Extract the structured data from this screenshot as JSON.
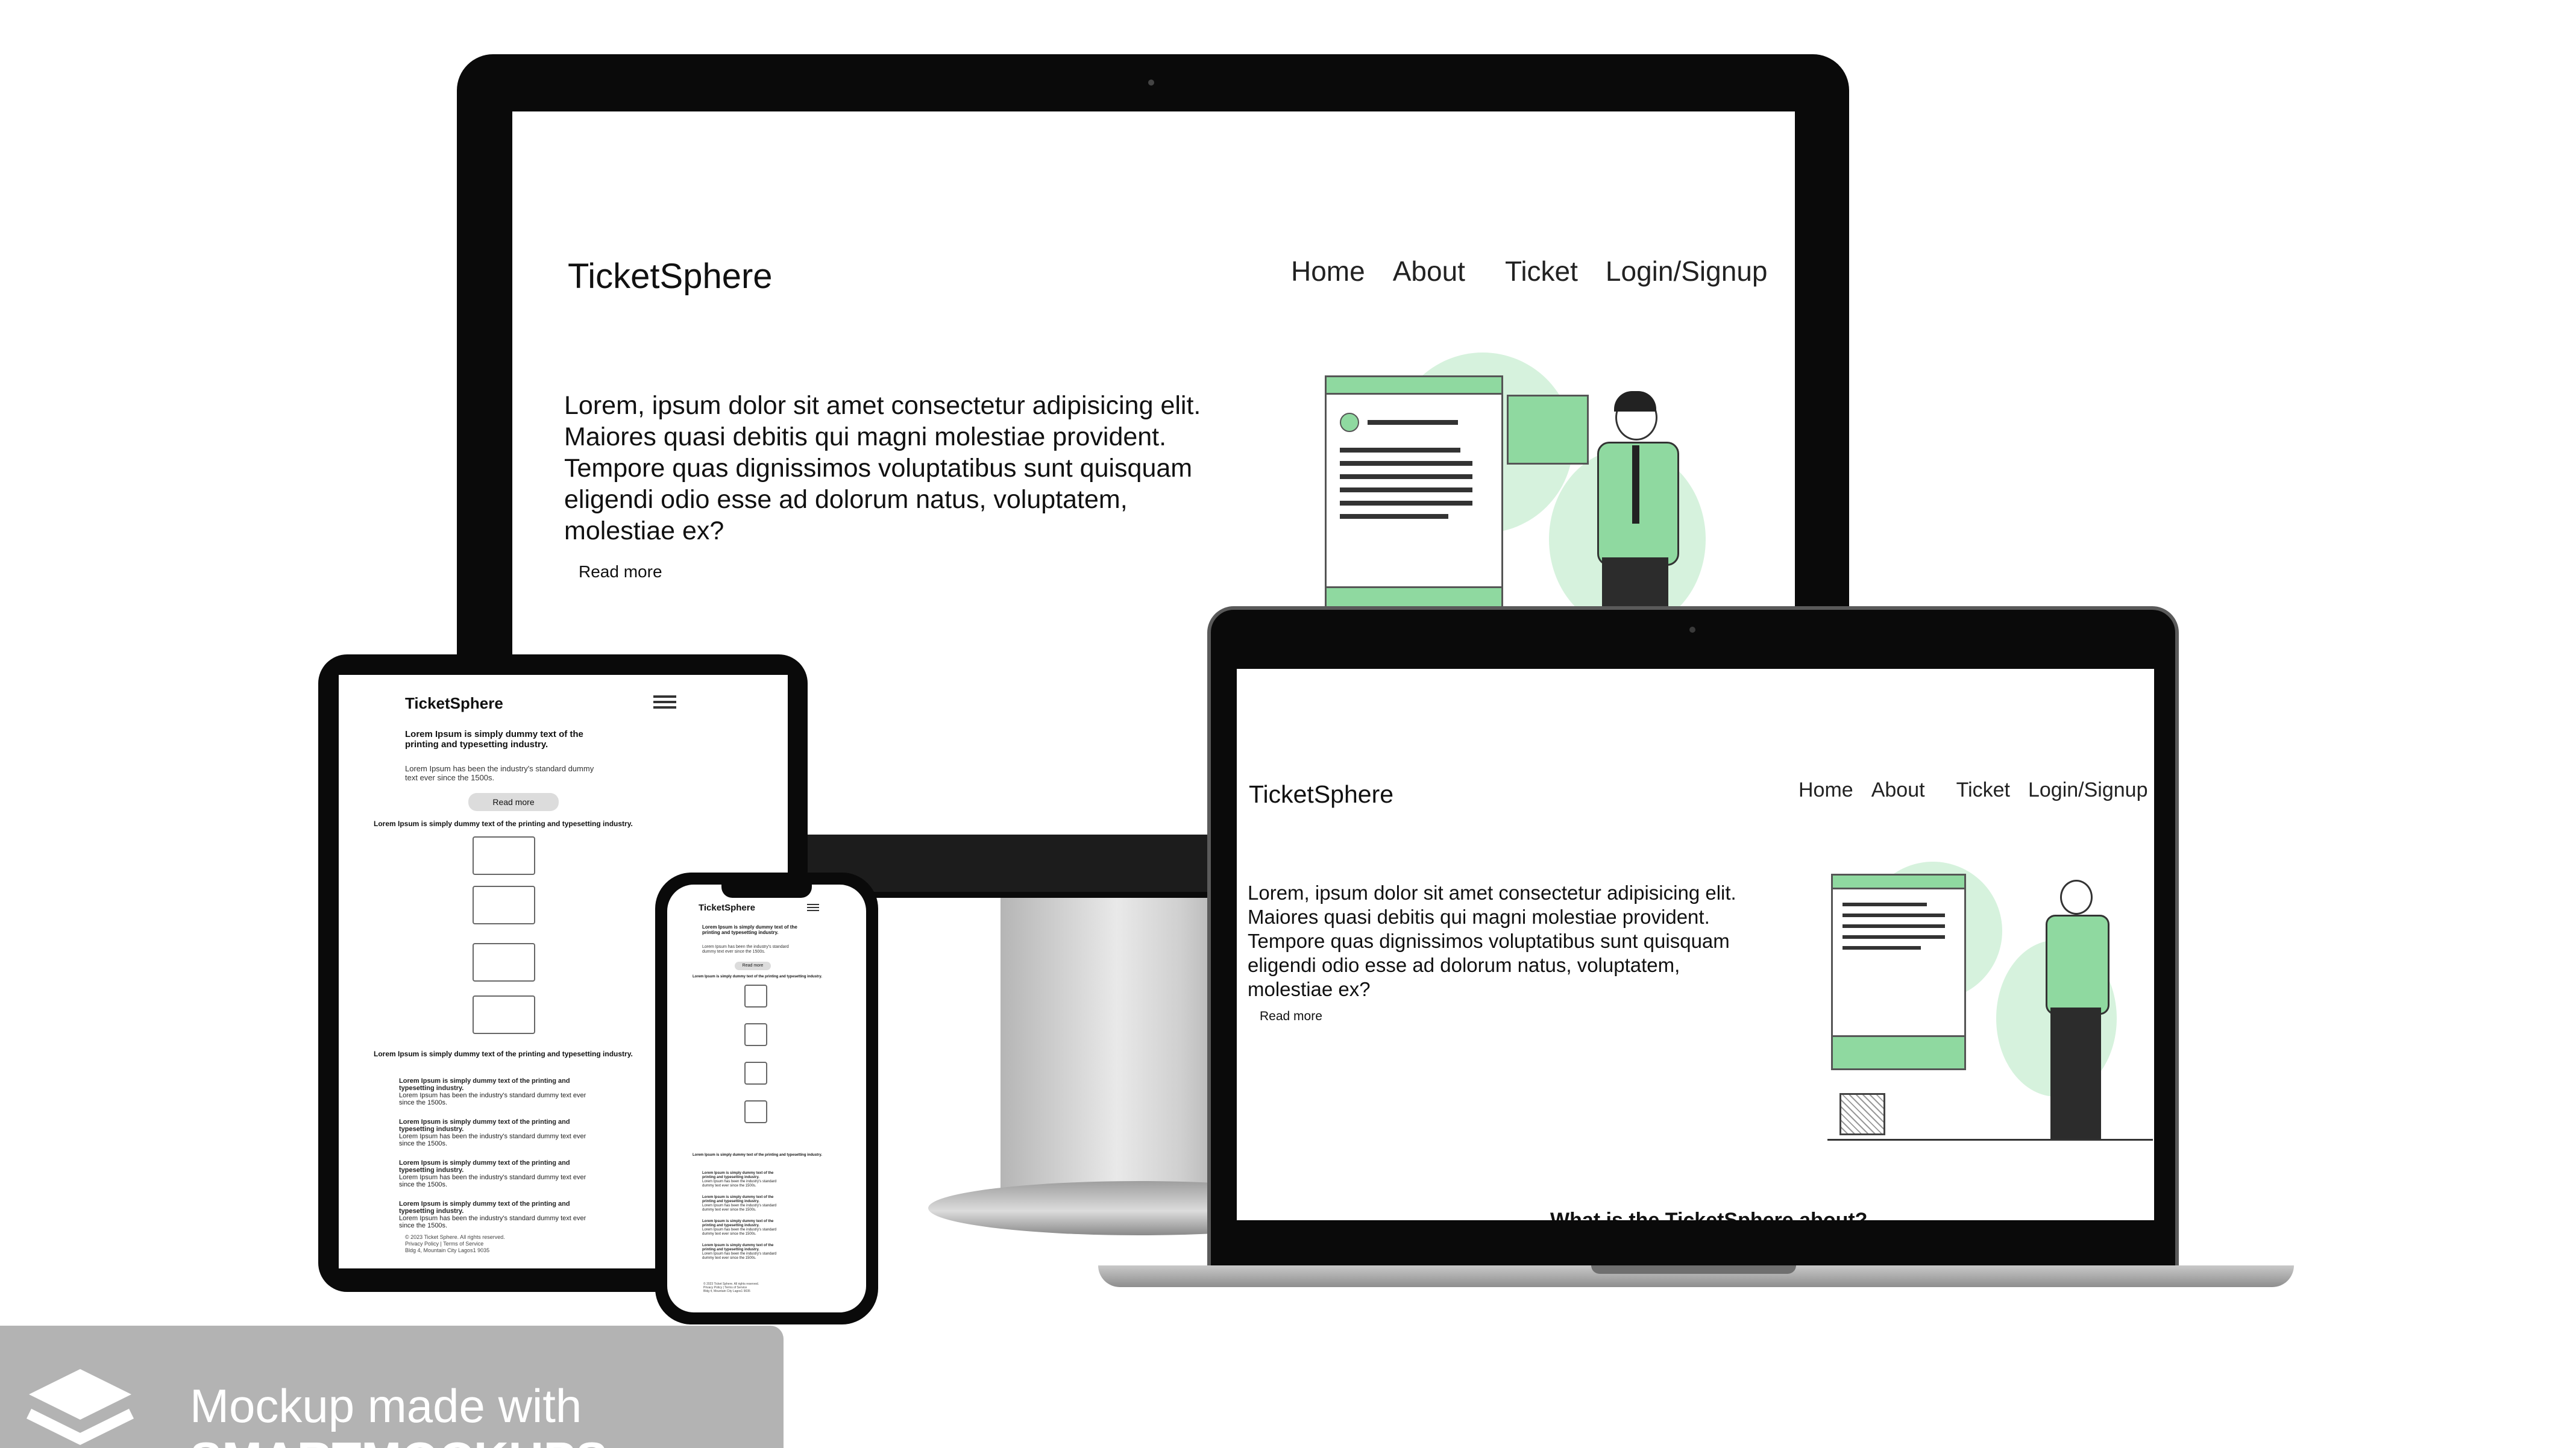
{
  "site": {
    "brand": "TicketSphere",
    "nav": [
      "Home",
      "About",
      "Ticket",
      "Login/Signup"
    ],
    "hero_text": "Lorem, ipsum dolor sit amet consectetur adipisicing elit. Maiores quasi debitis qui magni molestiae provident. Tempore quas dignissimos voluptatibus sunt quisquam eligendi odio esse ad dolorum natus, voluptatem, molestiae ex?",
    "read_more": "Read more"
  },
  "laptop": {
    "partial_heading": "What is the TicketSphere about?"
  },
  "mobile": {
    "hero_bold": "Lorem Ipsum is simply dummy text of the printing and typesetting industry.",
    "hero_rest": "Lorem Ipsum has been the industry's standard dummy text ever since the 1500s.",
    "read_more": "Read more",
    "section_line": "Lorem Ipsum is simply dummy text of the printing and typesetting industry.",
    "card_title": "Lorem Ipsum is simply dummy text of the printing and typesetting industry.",
    "card_body": "Lorem Ipsum has been the industry's standard dummy text ever since the 1500s.",
    "footer": [
      "© 2023 Ticket Sphere. All rights reserved.",
      "Privacy Policy | Terms of Service",
      "Bldg 4, Mountain City Lagos1 9035"
    ]
  },
  "watermark": {
    "line1": "Mockup made with",
    "line2": "SMARTMOCKUPS"
  },
  "colors": {
    "accent_green": "#8fd9a0",
    "illustration_green": "#c9efd3",
    "bezel": "#0a0a0a",
    "watermark_bg": "#b3b3b3"
  }
}
